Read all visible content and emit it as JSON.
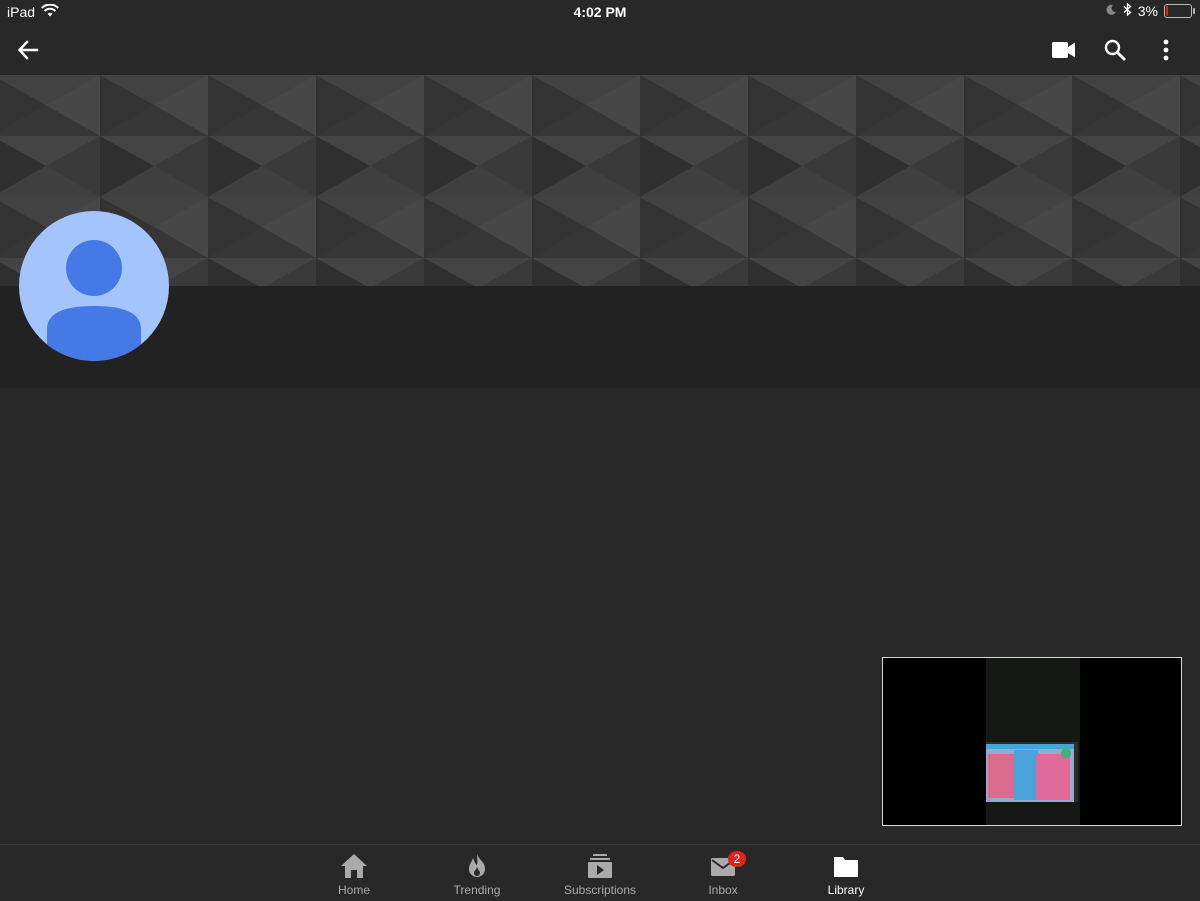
{
  "status_bar": {
    "device": "iPad",
    "time": "4:02 PM",
    "battery_percent": "3%",
    "battery_level": 0.03,
    "icons": [
      "wifi-icon",
      "moon-icon",
      "bluetooth-icon",
      "battery-icon"
    ]
  },
  "app_bar": {
    "icons": [
      "back-arrow-icon",
      "video-camera-icon",
      "search-icon",
      "more-vertical-icon"
    ]
  },
  "channel": {
    "avatar_icon": "default-user-icon"
  },
  "bottom_nav": {
    "items": [
      {
        "label": "Home",
        "icon": "home-icon"
      },
      {
        "label": "Trending",
        "icon": "flame-icon"
      },
      {
        "label": "Subscriptions",
        "icon": "subscriptions-icon"
      },
      {
        "label": "Inbox",
        "icon": "mail-icon",
        "badge": "2"
      },
      {
        "label": "Library",
        "icon": "folder-icon"
      }
    ],
    "active": "Library"
  },
  "colors": {
    "background": "#282828",
    "header_strip": "#222222",
    "avatar_bg": "#a4c4fd",
    "avatar_fg": "#4479e6",
    "badge": "#e0241c"
  }
}
